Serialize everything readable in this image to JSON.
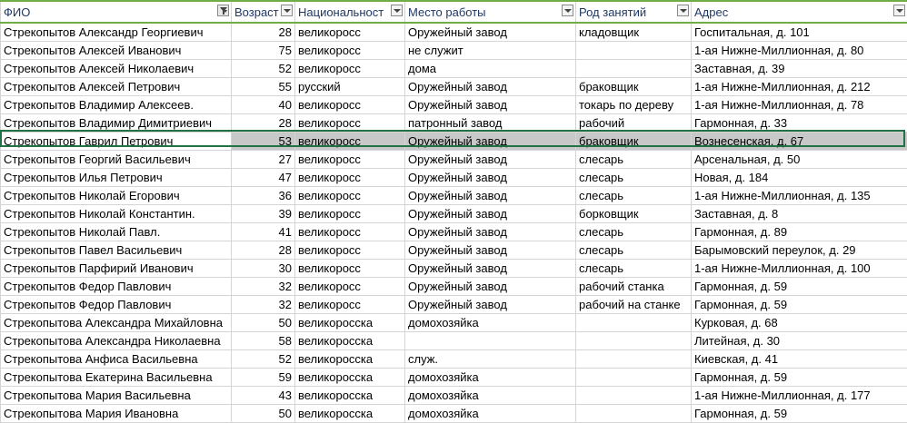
{
  "headers": [
    "ФИО",
    "Возраст",
    "Национальност",
    "Место работы",
    "Род занятий",
    "Адрес"
  ],
  "filter": {
    "active_column": "ФИО"
  },
  "selected_row_index": 6,
  "rows": [
    [
      "Стрекопытов Александр Георгиевич",
      "28",
      "великоросс",
      "Оружейный завод",
      "кладовщик",
      "Госпитальная, д. 101"
    ],
    [
      "Стрекопытов Алексей Иванович",
      "75",
      "великоросс",
      "не служит",
      "",
      "1-ая Нижне-Миллионная, д. 80"
    ],
    [
      "Стрекопытов Алексей Николаевич",
      "52",
      "великоросс",
      "дома",
      "",
      "Заставная, д. 39"
    ],
    [
      "Стрекопытов Алексей Петрович",
      "55",
      "русский",
      "Оружейный завод",
      "браковщик",
      "1-ая Нижне-Миллионная, д. 212"
    ],
    [
      "Стрекопытов Владимир Алексеев.",
      "40",
      "великоросс",
      "Оружейный завод",
      "токарь по дереву",
      "1-ая Нижне-Миллионная, д. 78"
    ],
    [
      "Стрекопытов Владимир Димитриевич",
      "28",
      "великоросс",
      "патронный завод",
      "рабочий",
      "Гармонная, д. 33"
    ],
    [
      "Стрекопытов Гаврил Петрович",
      "53",
      "великоросс",
      "Оружейный завод",
      "браковщик",
      "Вознесенская, д. 67"
    ],
    [
      "Стрекопытов Георгий Васильевич",
      "27",
      "великоросс",
      "Оружейный завод",
      "слесарь",
      "Арсенальная, д. 50"
    ],
    [
      "Стрекопытов Илья Петрович",
      "47",
      "великоросс",
      "Оружейный завод",
      "слесарь",
      "Новая, д. 184"
    ],
    [
      "Стрекопытов Николай Егорович",
      "36",
      "великоросс",
      "Оружейный завод",
      "слесарь",
      "1-ая Нижне-Миллионная, д. 135"
    ],
    [
      "Стрекопытов Николай Константин.",
      "39",
      "великоросс",
      "Оружейный завод",
      "борковщик",
      "Заставная, д. 8"
    ],
    [
      "Стрекопытов Николай Павл.",
      "41",
      "великоросс",
      "Оружейный завод",
      "слесарь",
      "Гармонная, д. 89"
    ],
    [
      "Стрекопытов Павел Васильевич",
      "28",
      "великоросс",
      "Оружейный завод",
      "слесарь",
      "Барымовский переулок, д. 29"
    ],
    [
      "Стрекопытов Парфирий Иванович",
      "30",
      "великоросс",
      "Оружейный завод",
      "слесарь",
      "1-ая Нижне-Миллионная, д. 100"
    ],
    [
      "Стрекопытов Федор Павлович",
      "32",
      "великоросс",
      "Оружейный завод",
      "рабочий станка",
      "Гармонная, д. 59"
    ],
    [
      "Стрекопытов Федор Павлович",
      "32",
      "великоросс",
      "Оружейный завод",
      "рабочий на станке",
      "Гармонная, д. 59"
    ],
    [
      "Стрекопытова Александра Михайловна",
      "50",
      "великоросска",
      "домохозяйка",
      "",
      "Курковая, д. 68"
    ],
    [
      "Стрекопытова Александра Николаевна",
      "58",
      "великоросска",
      "",
      "",
      "Литейная, д. 30"
    ],
    [
      "Стрекопытова Анфиса Васильевна",
      "52",
      "великоросска",
      "служ.",
      "",
      "Киевская, д. 41"
    ],
    [
      "Стрекопытова Екатерина Васильевна",
      "59",
      "великоросска",
      "домохозяйка",
      "",
      "Гармонная, д. 59"
    ],
    [
      "Стрекопытова Мария Васильевна",
      "43",
      "великоросска",
      "домохозяйка",
      "",
      "1-ая Нижне-Миллионная, д. 177"
    ],
    [
      "Стрекопытова Мария Ивановна",
      "50",
      "великоросска",
      "домохозяйка",
      "",
      "Гармонная, д. 59"
    ]
  ]
}
